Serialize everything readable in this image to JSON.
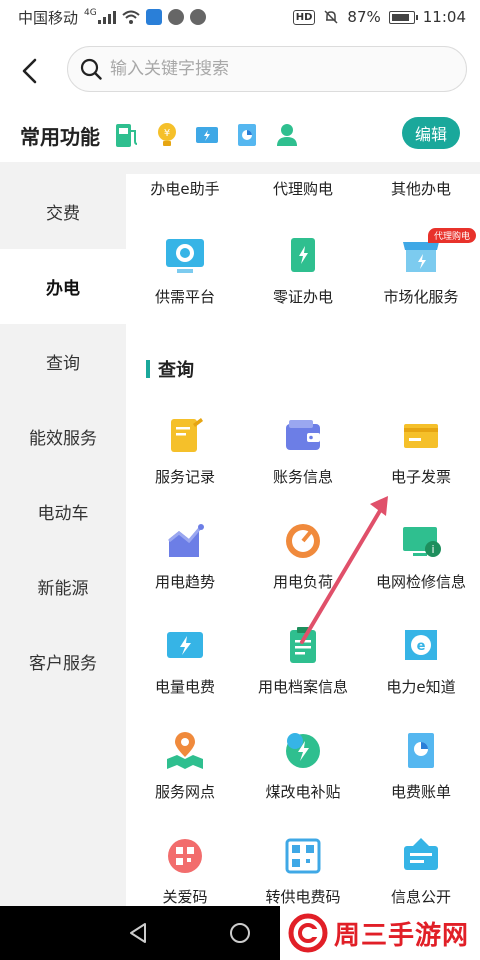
{
  "status": {
    "carrier": "中国移动",
    "network": "4G",
    "battery_percent": "87%",
    "time": "11:04",
    "hd": "HD"
  },
  "search": {
    "placeholder": "输入关键字搜索"
  },
  "common": {
    "title": "常用功能",
    "edit_label": "编辑"
  },
  "sidebar": {
    "items": [
      {
        "label": "交费"
      },
      {
        "label": "办电"
      },
      {
        "label": "查询"
      },
      {
        "label": "能效服务"
      },
      {
        "label": "电动车"
      },
      {
        "label": "新能源"
      },
      {
        "label": "客户服务"
      }
    ],
    "active_index": 1
  },
  "content": {
    "top_row": [
      "办电e助手",
      "代理购电",
      "其他办电"
    ],
    "row2": [
      "供需平台",
      "零证办电",
      "市场化服务"
    ],
    "badge": "代理购电",
    "section": "查询",
    "grid": [
      [
        "服务记录",
        "账务信息",
        "电子发票"
      ],
      [
        "用电趋势",
        "用电负荷",
        "电网检修信息"
      ],
      [
        "电量电费",
        "用电档案信息",
        "电力e知道"
      ],
      [
        "服务网点",
        "煤改电补贴",
        "电费账单"
      ],
      [
        "关爱码",
        "转供电费码",
        "信息公开"
      ]
    ]
  },
  "watermark": {
    "text": "周三手游网"
  },
  "colors": {
    "accent": "#1aa89b",
    "annotation_arrow": "#e0506a",
    "badge": "#e8322b"
  }
}
